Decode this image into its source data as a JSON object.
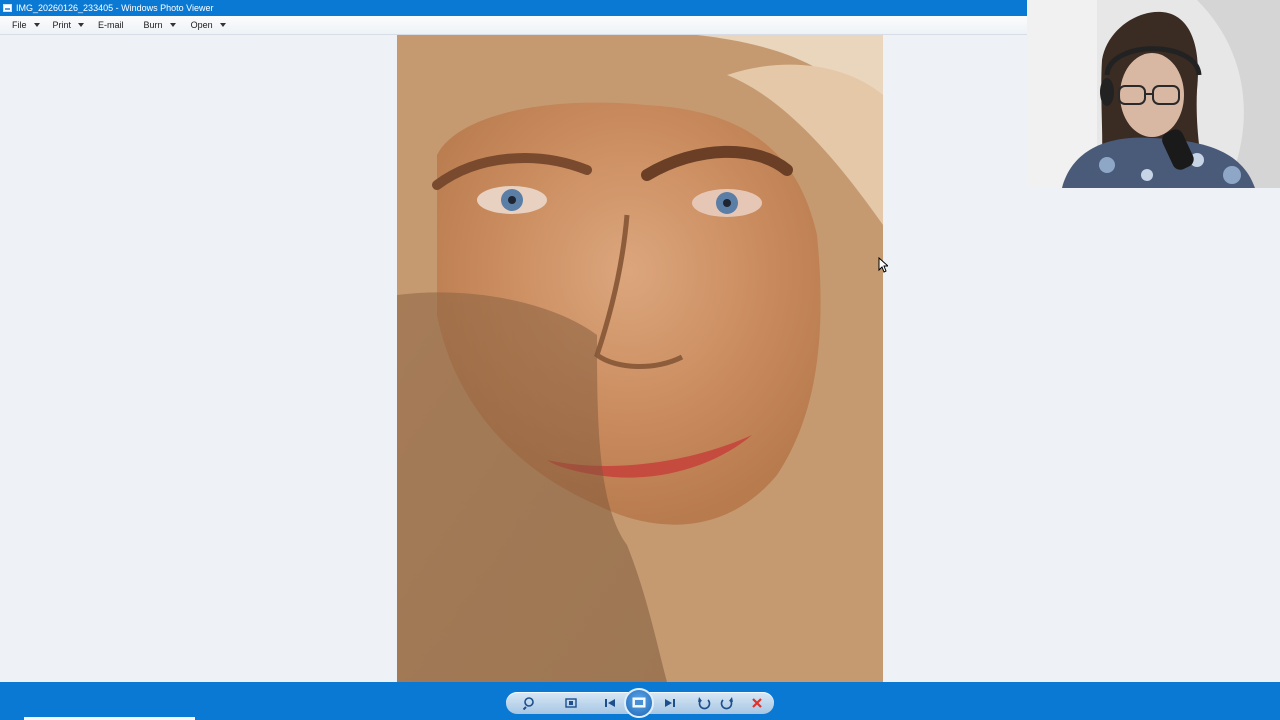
{
  "window": {
    "title": "IMG_20260126_233405 - Windows Photo Viewer"
  },
  "menu": {
    "file_label": "File",
    "print_label": "Print",
    "email_label": "E-mail",
    "burn_label": "Burn",
    "open_label": "Open"
  },
  "icons": {
    "app": "photo-viewer-icon",
    "zoom": "magnifier-icon",
    "actual_size": "actual-size-icon",
    "previous": "previous-icon",
    "slideshow": "slideshow-icon",
    "next": "next-icon",
    "rotate_left": "rotate-counterclockwise-icon",
    "rotate_right": "rotate-clockwise-icon",
    "delete": "delete-icon"
  },
  "colors": {
    "titlebar": "#0a79d3",
    "viewer_bg": "#eef2f7",
    "delete": "#e0322b"
  }
}
